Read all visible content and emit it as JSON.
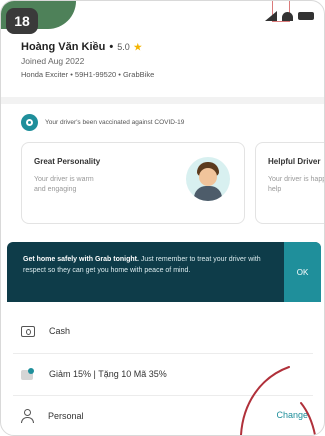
{
  "index_badge": "18",
  "driver": {
    "name": "Hoàng Văn Kiều",
    "rating": "5.0",
    "joined": "Joined Aug 2022",
    "vehicle": "Honda Exciter • 59H1-99520 • GrabBike"
  },
  "covid_notice": "Your driver's been vaccinated against COVID-19",
  "compliments": [
    {
      "title": "Great Personality",
      "desc": "Your driver is warm and engaging"
    },
    {
      "title": "Helpful Driver",
      "desc": "Your driver is happy to help"
    }
  ],
  "banner": {
    "title": "Get home safely with Grab tonight.",
    "body": "Just remember to treat your driver with respect so they can get you home with peace of mind.",
    "ok": "OK"
  },
  "payment": {
    "method": "Cash",
    "promo": "Giảm 15% | Tặng 10 Mã 35%",
    "profile": "Personal",
    "change": "Change"
  },
  "colors": {
    "accent": "#1f8f9b",
    "banner_bg": "#0e3c49"
  }
}
